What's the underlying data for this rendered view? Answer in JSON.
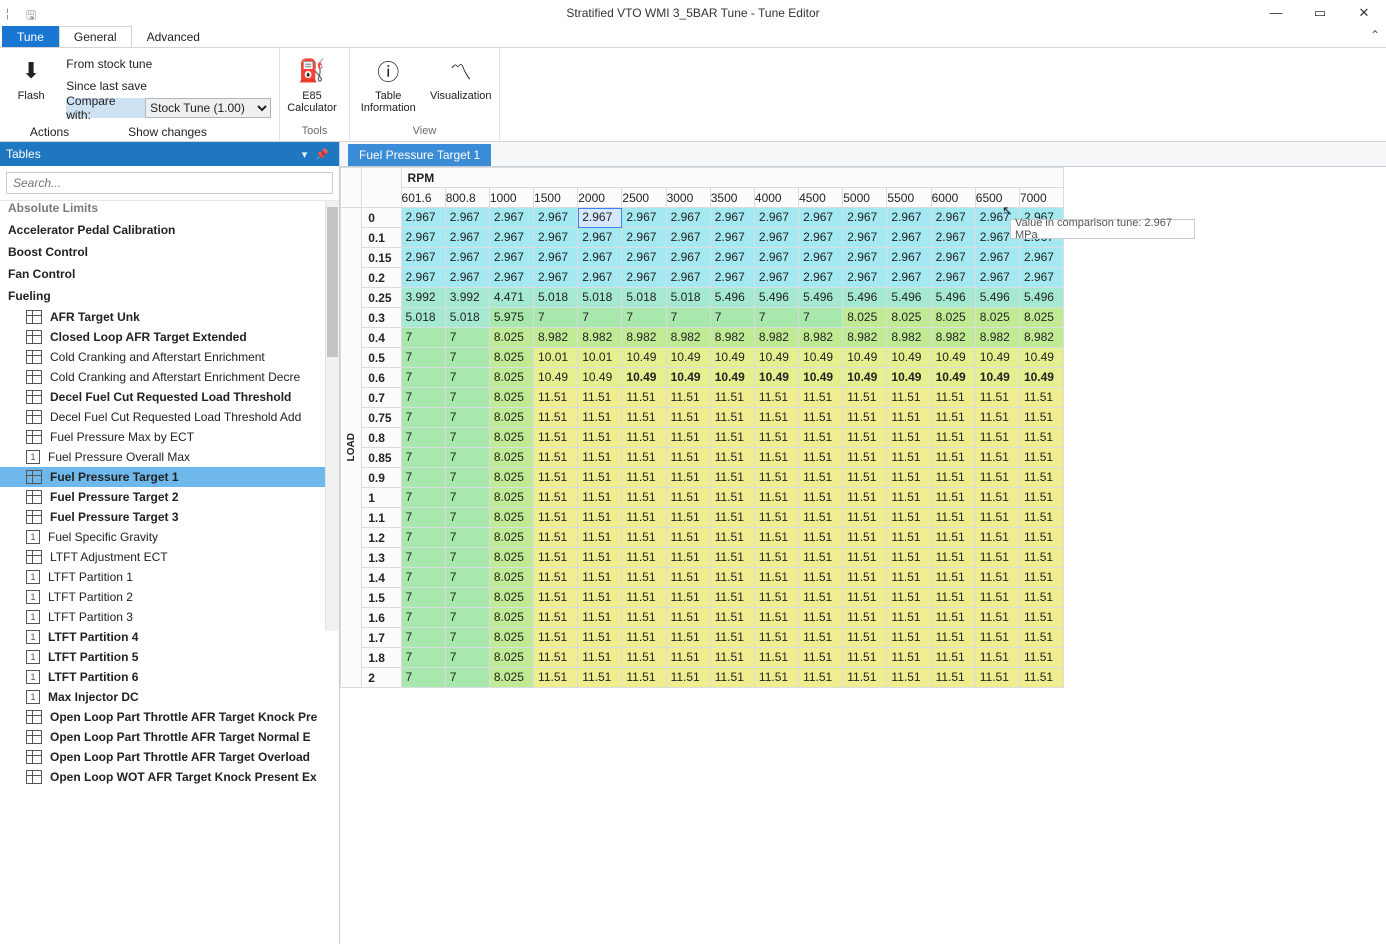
{
  "window": {
    "title": "Stratified VTO WMI 3_5BAR Tune - Tune Editor"
  },
  "ribbon": {
    "tabs": {
      "file": "Tune",
      "general": "General",
      "advanced": "Advanced"
    },
    "actions": {
      "flash": "Flash",
      "from_stock": "From stock tune",
      "since_save": "Since last save",
      "compare_label": "Compare with:",
      "compare_value": "Stock Tune (1.00)",
      "group": "Actions",
      "show": "Show changes"
    },
    "tools": {
      "e85": "E85 Calculator",
      "group": "Tools"
    },
    "view": {
      "table_info": "Table Information",
      "visualization": "Visualization",
      "group": "View"
    }
  },
  "panel": {
    "title": "Tables",
    "search_ph": "Search..."
  },
  "tree": {
    "abs_limits": "Absolute Limits",
    "headers": [
      "Accelerator Pedal Calibration",
      "Boost Control",
      "Fan Control",
      "Fueling"
    ],
    "items": [
      {
        "t": "AFR Target Unk",
        "b": 1,
        "ic": "tb"
      },
      {
        "t": "Closed Loop AFR Target Extended",
        "b": 1,
        "ic": "tb"
      },
      {
        "t": "Cold Cranking and Afterstart Enrichment",
        "b": 0,
        "ic": "tb"
      },
      {
        "t": "Cold Cranking and Afterstart Enrichment Decre",
        "b": 0,
        "ic": "tb"
      },
      {
        "t": "Decel Fuel Cut Requested Load Threshold",
        "b": 1,
        "ic": "tb"
      },
      {
        "t": "Decel Fuel Cut Requested Load Threshold Add",
        "b": 0,
        "ic": "tb"
      },
      {
        "t": "Fuel Pressure Max by ECT",
        "b": 0,
        "ic": "tb"
      },
      {
        "t": "Fuel Pressure Overall Max",
        "b": 0,
        "ic": "one"
      },
      {
        "t": "Fuel Pressure Target 1",
        "b": 1,
        "ic": "tb",
        "sel": 1
      },
      {
        "t": "Fuel Pressure Target 2",
        "b": 1,
        "ic": "tb"
      },
      {
        "t": "Fuel Pressure Target 3",
        "b": 1,
        "ic": "tb"
      },
      {
        "t": "Fuel Specific Gravity",
        "b": 0,
        "ic": "one"
      },
      {
        "t": "LTFT Adjustment ECT",
        "b": 0,
        "ic": "tb"
      },
      {
        "t": "LTFT Partition 1",
        "b": 0,
        "ic": "one"
      },
      {
        "t": "LTFT Partition 2",
        "b": 0,
        "ic": "one"
      },
      {
        "t": "LTFT Partition 3",
        "b": 0,
        "ic": "one"
      },
      {
        "t": "LTFT Partition 4",
        "b": 1,
        "ic": "one"
      },
      {
        "t": "LTFT Partition 5",
        "b": 1,
        "ic": "one"
      },
      {
        "t": "LTFT Partition 6",
        "b": 1,
        "ic": "one"
      },
      {
        "t": "Max Injector DC",
        "b": 1,
        "ic": "one"
      },
      {
        "t": "Open Loop Part Throttle AFR Target Knock Pre",
        "b": 1,
        "ic": "tb"
      },
      {
        "t": "Open Loop Part Throttle AFR Target Normal E",
        "b": 1,
        "ic": "tb"
      },
      {
        "t": "Open Loop Part Throttle AFR Target Overload",
        "b": 1,
        "ic": "tb"
      },
      {
        "t": "Open Loop WOT AFR Target Knock Present Ex",
        "b": 1,
        "ic": "tb"
      }
    ]
  },
  "editor": {
    "tab": "Fuel Pressure Target 1",
    "rpm_label": "RPM",
    "load_label": "LOAD",
    "tooltip": "Value in comparison tune: 2.967 MPa"
  },
  "chart_data": {
    "type": "table",
    "col_headers": [
      "601.6",
      "800.8",
      "1000",
      "1500",
      "2000",
      "2500",
      "3000",
      "3500",
      "4000",
      "4500",
      "5000",
      "5500",
      "6000",
      "6500",
      "7000"
    ],
    "row_headers": [
      "0",
      "0.1",
      "0.15",
      "0.2",
      "0.25",
      "0.3",
      "0.4",
      "0.5",
      "0.6",
      "0.7",
      "0.75",
      "0.8",
      "0.85",
      "0.9",
      "1",
      "1.1",
      "1.2",
      "1.3",
      "1.4",
      "1.5",
      "1.6",
      "1.7",
      "1.8",
      "2"
    ],
    "rows": [
      [
        "2.967",
        "2.967",
        "2.967",
        "2.967",
        "2.967",
        "2.967",
        "2.967",
        "2.967",
        "2.967",
        "2.967",
        "2.967",
        "2.967",
        "2.967",
        "2.967",
        "2.967"
      ],
      [
        "2.967",
        "2.967",
        "2.967",
        "2.967",
        "2.967",
        "2.967",
        "2.967",
        "2.967",
        "2.967",
        "2.967",
        "2.967",
        "2.967",
        "2.967",
        "2.967",
        "2.967"
      ],
      [
        "2.967",
        "2.967",
        "2.967",
        "2.967",
        "2.967",
        "2.967",
        "2.967",
        "2.967",
        "2.967",
        "2.967",
        "2.967",
        "2.967",
        "2.967",
        "2.967",
        "2.967"
      ],
      [
        "2.967",
        "2.967",
        "2.967",
        "2.967",
        "2.967",
        "2.967",
        "2.967",
        "2.967",
        "2.967",
        "2.967",
        "2.967",
        "2.967",
        "2.967",
        "2.967",
        "2.967"
      ],
      [
        "3.992",
        "3.992",
        "4.471",
        "5.018",
        "5.018",
        "5.018",
        "5.018",
        "5.496",
        "5.496",
        "5.496",
        "5.496",
        "5.496",
        "5.496",
        "5.496",
        "5.496"
      ],
      [
        "5.018",
        "5.018",
        "5.975",
        "7",
        "7",
        "7",
        "7",
        "7",
        "7",
        "7",
        "8.025",
        "8.025",
        "8.025",
        "8.025",
        "8.025"
      ],
      [
        "7",
        "7",
        "8.025",
        "8.982",
        "8.982",
        "8.982",
        "8.982",
        "8.982",
        "8.982",
        "8.982",
        "8.982",
        "8.982",
        "8.982",
        "8.982",
        "8.982"
      ],
      [
        "7",
        "7",
        "8.025",
        "10.01",
        "10.01",
        "10.49",
        "10.49",
        "10.49",
        "10.49",
        "10.49",
        "10.49",
        "10.49",
        "10.49",
        "10.49",
        "10.49"
      ],
      [
        "7",
        "7",
        "8.025",
        "10.49",
        "10.49",
        "10.49",
        "10.49",
        "10.49",
        "10.49",
        "10.49",
        "10.49",
        "10.49",
        "10.49",
        "10.49",
        "10.49"
      ],
      [
        "7",
        "7",
        "8.025",
        "11.51",
        "11.51",
        "11.51",
        "11.51",
        "11.51",
        "11.51",
        "11.51",
        "11.51",
        "11.51",
        "11.51",
        "11.51",
        "11.51"
      ],
      [
        "7",
        "7",
        "8.025",
        "11.51",
        "11.51",
        "11.51",
        "11.51",
        "11.51",
        "11.51",
        "11.51",
        "11.51",
        "11.51",
        "11.51",
        "11.51",
        "11.51"
      ],
      [
        "7",
        "7",
        "8.025",
        "11.51",
        "11.51",
        "11.51",
        "11.51",
        "11.51",
        "11.51",
        "11.51",
        "11.51",
        "11.51",
        "11.51",
        "11.51",
        "11.51"
      ],
      [
        "7",
        "7",
        "8.025",
        "11.51",
        "11.51",
        "11.51",
        "11.51",
        "11.51",
        "11.51",
        "11.51",
        "11.51",
        "11.51",
        "11.51",
        "11.51",
        "11.51"
      ],
      [
        "7",
        "7",
        "8.025",
        "11.51",
        "11.51",
        "11.51",
        "11.51",
        "11.51",
        "11.51",
        "11.51",
        "11.51",
        "11.51",
        "11.51",
        "11.51",
        "11.51"
      ],
      [
        "7",
        "7",
        "8.025",
        "11.51",
        "11.51",
        "11.51",
        "11.51",
        "11.51",
        "11.51",
        "11.51",
        "11.51",
        "11.51",
        "11.51",
        "11.51",
        "11.51"
      ],
      [
        "7",
        "7",
        "8.025",
        "11.51",
        "11.51",
        "11.51",
        "11.51",
        "11.51",
        "11.51",
        "11.51",
        "11.51",
        "11.51",
        "11.51",
        "11.51",
        "11.51"
      ],
      [
        "7",
        "7",
        "8.025",
        "11.51",
        "11.51",
        "11.51",
        "11.51",
        "11.51",
        "11.51",
        "11.51",
        "11.51",
        "11.51",
        "11.51",
        "11.51",
        "11.51"
      ],
      [
        "7",
        "7",
        "8.025",
        "11.51",
        "11.51",
        "11.51",
        "11.51",
        "11.51",
        "11.51",
        "11.51",
        "11.51",
        "11.51",
        "11.51",
        "11.51",
        "11.51"
      ],
      [
        "7",
        "7",
        "8.025",
        "11.51",
        "11.51",
        "11.51",
        "11.51",
        "11.51",
        "11.51",
        "11.51",
        "11.51",
        "11.51",
        "11.51",
        "11.51",
        "11.51"
      ],
      [
        "7",
        "7",
        "8.025",
        "11.51",
        "11.51",
        "11.51",
        "11.51",
        "11.51",
        "11.51",
        "11.51",
        "11.51",
        "11.51",
        "11.51",
        "11.51",
        "11.51"
      ],
      [
        "7",
        "7",
        "8.025",
        "11.51",
        "11.51",
        "11.51",
        "11.51",
        "11.51",
        "11.51",
        "11.51",
        "11.51",
        "11.51",
        "11.51",
        "11.51",
        "11.51"
      ],
      [
        "7",
        "7",
        "8.025",
        "11.51",
        "11.51",
        "11.51",
        "11.51",
        "11.51",
        "11.51",
        "11.51",
        "11.51",
        "11.51",
        "11.51",
        "11.51",
        "11.51"
      ],
      [
        "7",
        "7",
        "8.025",
        "11.51",
        "11.51",
        "11.51",
        "11.51",
        "11.51",
        "11.51",
        "11.51",
        "11.51",
        "11.51",
        "11.51",
        "11.51",
        "11.51"
      ],
      [
        "7",
        "7",
        "8.025",
        "11.51",
        "11.51",
        "11.51",
        "11.51",
        "11.51",
        "11.51",
        "11.51",
        "11.51",
        "11.51",
        "11.51",
        "11.51",
        "11.51"
      ]
    ],
    "selected": {
      "row": 0,
      "col": 4
    }
  }
}
